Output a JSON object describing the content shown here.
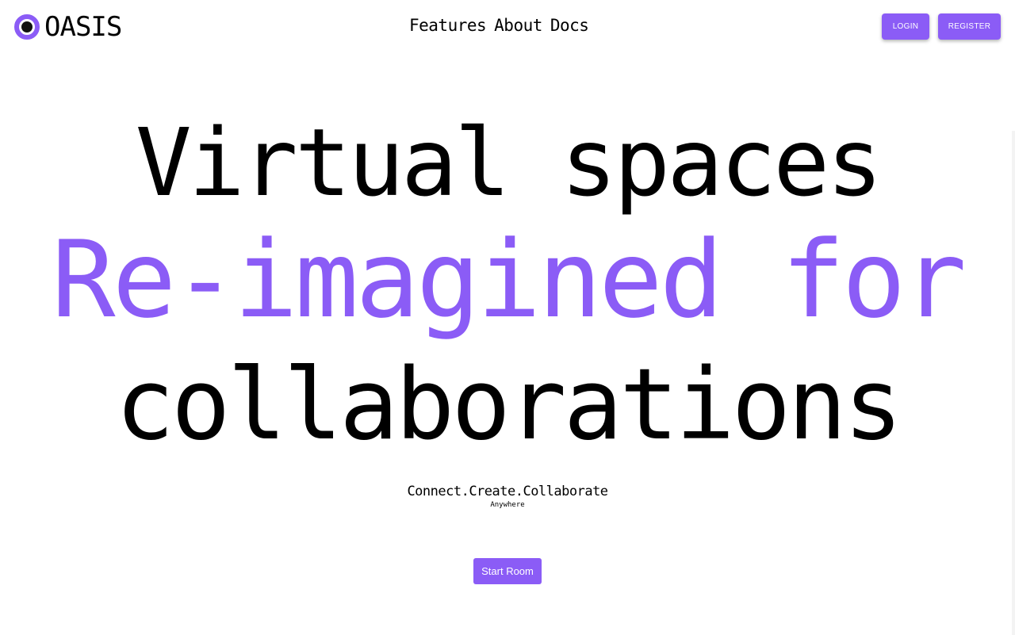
{
  "brand": {
    "name": "OASIS",
    "accent_color": "#8b5cf6"
  },
  "nav": {
    "items": [
      {
        "label": "Features"
      },
      {
        "label": "About"
      },
      {
        "label": "Docs"
      }
    ]
  },
  "auth": {
    "login_label": "LOGIN",
    "register_label": "REGISTER"
  },
  "hero": {
    "line1": "Virtual spaces",
    "line2": "Re-imagined for",
    "line3": "collaborations",
    "tagline": "Connect.Create.Collaborate",
    "subtagline": "Anywhere",
    "cta_label": "Start Room"
  }
}
